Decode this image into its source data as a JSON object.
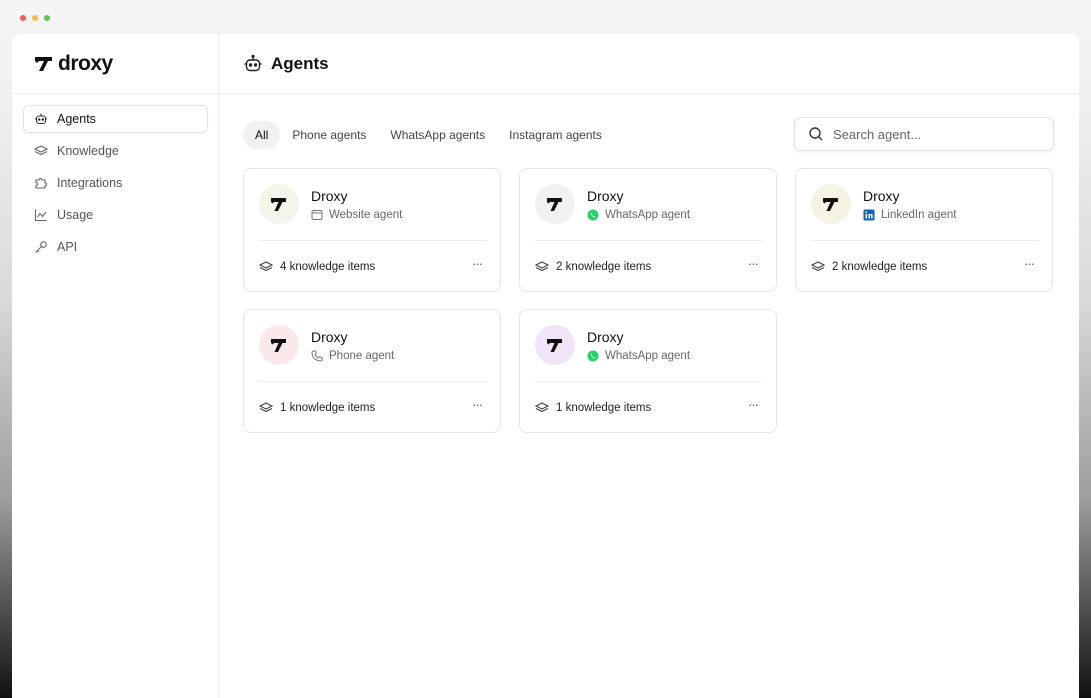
{
  "brand": {
    "name": "droxy"
  },
  "sidebar": {
    "items": [
      {
        "label": "Agents",
        "icon": "bot-icon",
        "active": true
      },
      {
        "label": "Knowledge",
        "icon": "layers-icon",
        "active": false
      },
      {
        "label": "Integrations",
        "icon": "puzzle-icon",
        "active": false
      },
      {
        "label": "Usage",
        "icon": "chart-icon",
        "active": false
      },
      {
        "label": "API",
        "icon": "key-icon",
        "active": false
      }
    ]
  },
  "header": {
    "title": "Agents",
    "icon": "bot-icon"
  },
  "filters": {
    "tabs": [
      {
        "label": "All",
        "active": true
      },
      {
        "label": "Phone agents",
        "active": false
      },
      {
        "label": "WhatsApp agents",
        "active": false
      },
      {
        "label": "Instagram agents",
        "active": false
      }
    ]
  },
  "search": {
    "placeholder": "Search agent...",
    "value": ""
  },
  "agents": [
    {
      "name": "Droxy",
      "type": "Website agent",
      "type_icon": "browser-window-icon",
      "knowledge": "4 knowledge items",
      "avatar_bg": "#f3f5ea"
    },
    {
      "name": "Droxy",
      "type": "WhatsApp agent",
      "type_icon": "whatsapp-icon",
      "knowledge": "2 knowledge items",
      "avatar_bg": "#f1f1f3"
    },
    {
      "name": "Droxy",
      "type": "LinkedIn agent",
      "type_icon": "linkedin-icon",
      "knowledge": "2 knowledge items",
      "avatar_bg": "#f4f3e4"
    },
    {
      "name": "Droxy",
      "type": "Phone agent",
      "type_icon": "phone-icon",
      "knowledge": "1 knowledge items",
      "avatar_bg": "#fbe9ea"
    },
    {
      "name": "Droxy",
      "type": "WhatsApp agent",
      "type_icon": "whatsapp-icon",
      "knowledge": "1 knowledge items",
      "avatar_bg": "#f1e4f9"
    }
  ],
  "colors": {
    "whatsapp": "#25d366",
    "linkedin": "#0a66c2"
  }
}
